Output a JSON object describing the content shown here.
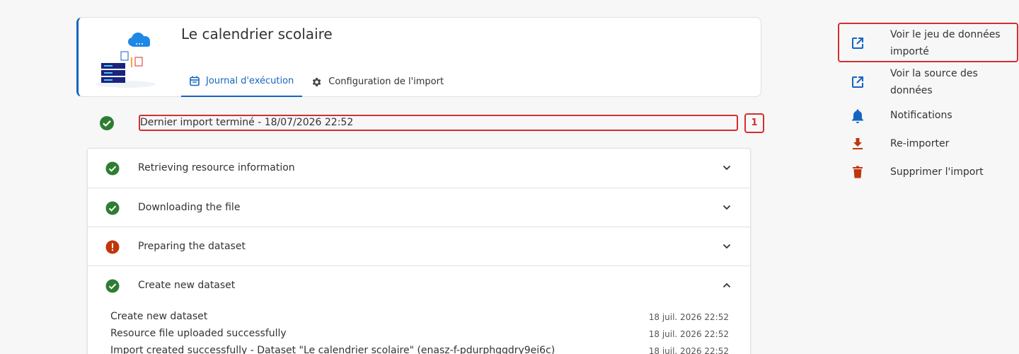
{
  "header": {
    "title": "Le calendrier scolaire",
    "tabs": [
      {
        "label": "Journal d'exécution",
        "active": true,
        "icon": "calendar-icon"
      },
      {
        "label": "Configuration de l'import",
        "active": false,
        "icon": "gear-icon"
      }
    ]
  },
  "status": {
    "text": "Dernier import terminé - 18/07/2026 22:52",
    "badge": "1",
    "state": "success"
  },
  "steps": [
    {
      "label": "Retrieving resource information",
      "state": "success",
      "expanded": false
    },
    {
      "label": "Downloading the file",
      "state": "success",
      "expanded": false
    },
    {
      "label": "Preparing the dataset",
      "state": "warning",
      "expanded": false
    },
    {
      "label": "Create new dataset",
      "state": "success",
      "expanded": true
    }
  ],
  "logs": [
    {
      "message": "Create new dataset",
      "date": "18 juil. 2026 22:52"
    },
    {
      "message": "Resource file uploaded successfully",
      "date": "18 juil. 2026 22:52"
    },
    {
      "message": "Import created successfully - Dataset \"Le calendrier scolaire\" (enasz-f-pdurphggdry9ei6c)",
      "date": "18 juil. 2026 22:52"
    }
  ],
  "actions": [
    {
      "line1": "Voir le jeu de données",
      "line2": "importé",
      "icon": "external-link-icon"
    },
    {
      "line1": "Voir la source des",
      "line2": "données",
      "icon": "external-link-icon"
    },
    {
      "line1": "Notifications",
      "icon": "bell-icon"
    },
    {
      "line1": "Re-importer",
      "icon": "download-icon"
    },
    {
      "line1": "Supprimer l'import",
      "icon": "trash-icon"
    }
  ],
  "colors": {
    "primary": "#1565c0",
    "success": "#2e7d32",
    "warning": "#bf360c",
    "highlight": "#d32f2f"
  }
}
